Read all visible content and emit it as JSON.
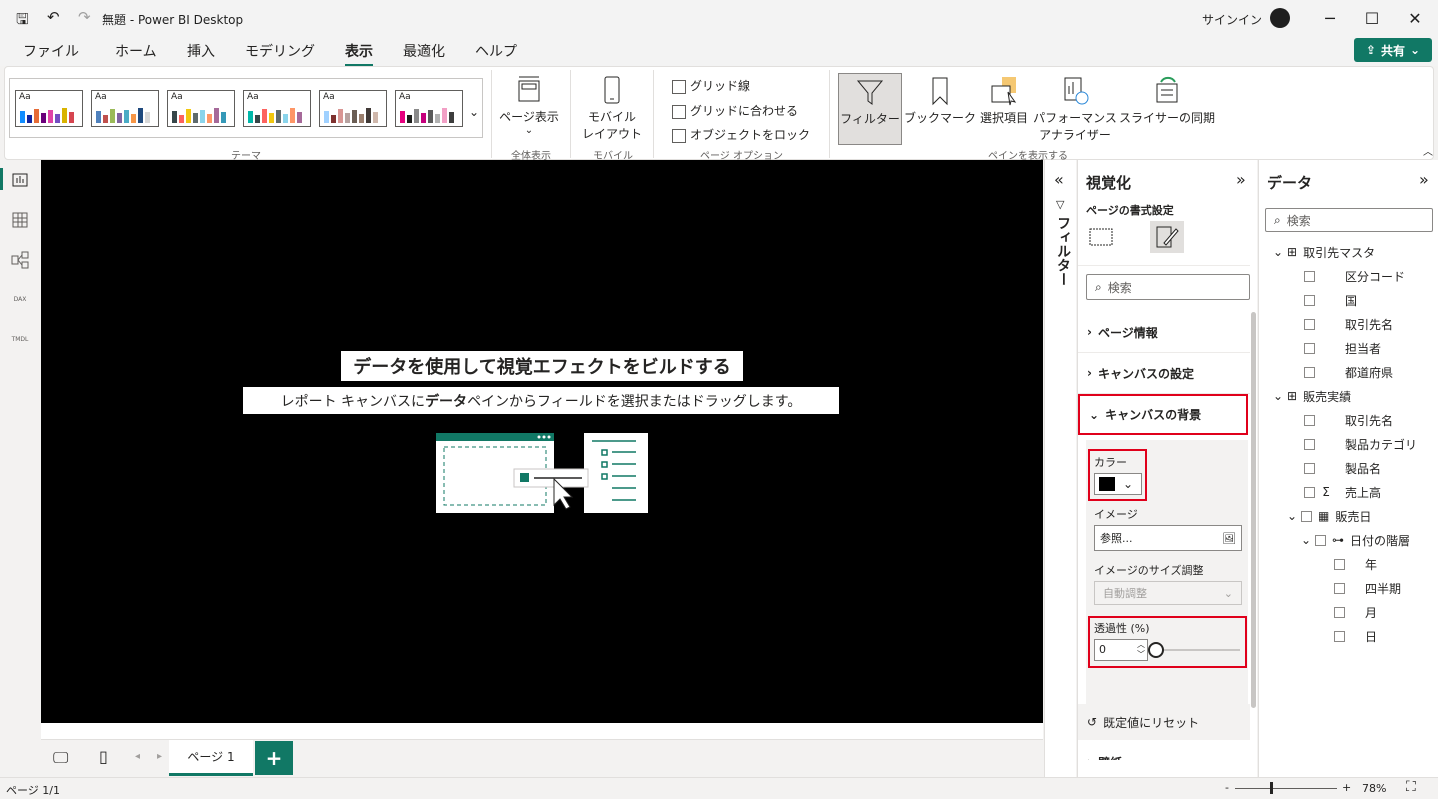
{
  "titlebar": {
    "title": "無題 - Power BI Desktop",
    "signin": "サインイン"
  },
  "tabs": [
    "ファイル",
    "ホーム",
    "挿入",
    "モデリング",
    "表示",
    "最適化",
    "ヘルプ"
  ],
  "share_label": "共有",
  "ribbon": {
    "themes_label": "テーマ",
    "page_view": "ページ表示",
    "page_view_group": "全体表示",
    "mobile_line1": "モバイル",
    "mobile_line2": "レイアウト",
    "mobile_group": "モバイル",
    "gridlines": "グリッド線",
    "snap_grid": "グリッドに合わせる",
    "lock_objects": "オブジェクトをロック",
    "page_options_group": "ページ オプション",
    "filter": "フィルター",
    "bookmark": "ブックマーク",
    "selection": "選択項目",
    "perf_line1": "パフォーマンス",
    "perf_line2": "アナライザー",
    "slicer_sync": "スライサーの同期",
    "pane_group": "ペインを表示する"
  },
  "canvas": {
    "title": "データを使用して視覚エフェクトをビルドする",
    "sub_pre": "レポート キャンバスに ",
    "sub_bold": "データ",
    "sub_post": " ペインからフィールドを選択またはドラッグします。"
  },
  "filter_strip_label": "フィルター",
  "viz": {
    "title": "視覚化",
    "subtitle": "ページの書式設定",
    "search_placeholder": "検索",
    "sections": [
      "ページ情報",
      "キャンバスの設定",
      "キャンバスの背景"
    ],
    "color_label": "カラー",
    "color_value": "#000000",
    "image_label": "イメージ",
    "browse": "参照...",
    "image_fit_label": "イメージのサイズ調整",
    "image_fit_value": "自動調整",
    "transparency_label": "透過性 (%)",
    "transparency_value": "0",
    "reset": "既定値にリセット",
    "wallpaper": "壁紙"
  },
  "data": {
    "title": "データ",
    "search_placeholder": "検索",
    "tables": [
      {
        "name": "取引先マスタ",
        "fields": [
          "区分コード",
          "国",
          "取引先名",
          "担当者",
          "都道府県"
        ]
      },
      {
        "name": "販売実績",
        "fields": [
          "取引先名",
          "製品カテゴリ",
          "製品名",
          "売上高"
        ]
      }
    ],
    "date_field": "販売日",
    "hierarchy": "日付の階層",
    "levels": [
      "年",
      "四半期",
      "月",
      "日"
    ]
  },
  "pages": {
    "tab": "ページ 1",
    "add": "+"
  },
  "status": {
    "page": "ページ 1/1",
    "zoom": "78%",
    "minus": "-",
    "plus": "+"
  },
  "theme_colors": [
    [
      "#118dff",
      "#12239e",
      "#e66c37",
      "#6b007b",
      "#e044a7",
      "#744ec2",
      "#d9b300",
      "#d64550"
    ],
    [
      "#4f81bd",
      "#c0504d",
      "#9bbb59",
      "#8064a2",
      "#4bacc6",
      "#f79646",
      "#1f497d",
      "#d8d8d8"
    ],
    [
      "#374649",
      "#fd625e",
      "#f2c80f",
      "#5f6b6d",
      "#8ad4eb",
      "#fe9666",
      "#a66999",
      "#3599b8"
    ],
    [
      "#01b8aa",
      "#374649",
      "#fd625e",
      "#f2c80f",
      "#5f6b6d",
      "#8ad4eb",
      "#fe9666",
      "#a66999"
    ],
    [
      "#a0d1ff",
      "#7f312f",
      "#d99694",
      "#b7a3a1",
      "#6b5e54",
      "#9a7f6e",
      "#413a37",
      "#cfb7ab"
    ],
    [
      "#e6007e",
      "#1d1d1b",
      "#8a8a8a",
      "#c5007c",
      "#5a5a5a",
      "#b2b2b2",
      "#f29fc5",
      "#3d3d3d"
    ]
  ]
}
